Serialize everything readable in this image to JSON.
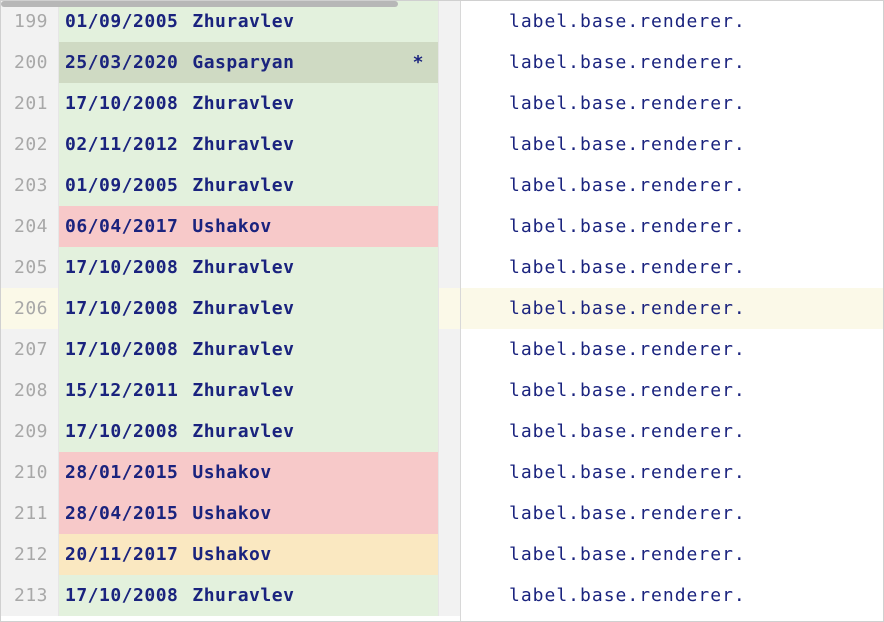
{
  "scrollbar": {
    "thumb_width_pct": 45
  },
  "code_text": "label.base.renderer.",
  "highlight_line": 206,
  "rows": [
    {
      "line": 199,
      "date": "01/09/2005",
      "author": "Zhuravlev",
      "bg": "green",
      "mark": ""
    },
    {
      "line": 200,
      "date": "25/03/2020",
      "author": "Gasparyan",
      "bg": "olive",
      "mark": "*"
    },
    {
      "line": 201,
      "date": "17/10/2008",
      "author": "Zhuravlev",
      "bg": "green",
      "mark": ""
    },
    {
      "line": 202,
      "date": "02/11/2012",
      "author": "Zhuravlev",
      "bg": "green",
      "mark": ""
    },
    {
      "line": 203,
      "date": "01/09/2005",
      "author": "Zhuravlev",
      "bg": "green",
      "mark": ""
    },
    {
      "line": 204,
      "date": "06/04/2017",
      "author": "Ushakov",
      "bg": "red",
      "mark": ""
    },
    {
      "line": 205,
      "date": "17/10/2008",
      "author": "Zhuravlev",
      "bg": "green",
      "mark": ""
    },
    {
      "line": 206,
      "date": "17/10/2008",
      "author": "Zhuravlev",
      "bg": "green",
      "mark": ""
    },
    {
      "line": 207,
      "date": "17/10/2008",
      "author": "Zhuravlev",
      "bg": "green",
      "mark": ""
    },
    {
      "line": 208,
      "date": "15/12/2011",
      "author": "Zhuravlev",
      "bg": "green",
      "mark": ""
    },
    {
      "line": 209,
      "date": "17/10/2008",
      "author": "Zhuravlev",
      "bg": "green",
      "mark": ""
    },
    {
      "line": 210,
      "date": "28/01/2015",
      "author": "Ushakov",
      "bg": "red",
      "mark": ""
    },
    {
      "line": 211,
      "date": "28/04/2015",
      "author": "Ushakov",
      "bg": "red",
      "mark": ""
    },
    {
      "line": 212,
      "date": "20/11/2017",
      "author": "Ushakov",
      "bg": "yellow",
      "mark": ""
    },
    {
      "line": 213,
      "date": "17/10/2008",
      "author": "Zhuravlev",
      "bg": "green",
      "mark": ""
    }
  ]
}
